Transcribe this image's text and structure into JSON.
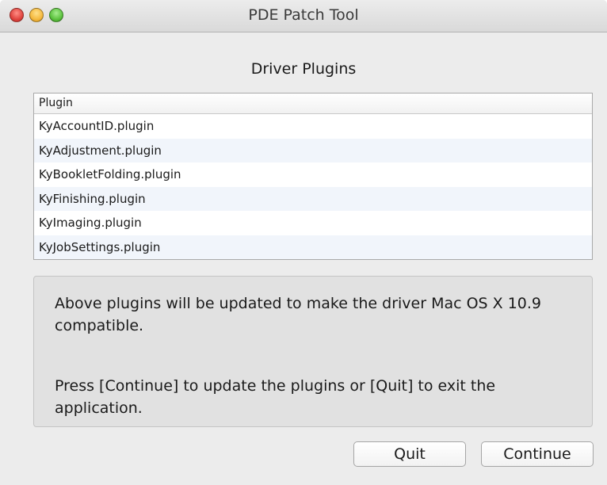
{
  "window": {
    "title": "PDE Patch Tool"
  },
  "section_title": "Driver Plugins",
  "table": {
    "header": "Plugin",
    "rows": [
      "KyAccountID.plugin",
      "KyAdjustment.plugin",
      "KyBookletFolding.plugin",
      "KyFinishing.plugin",
      "KyImaging.plugin",
      "KyJobSettings.plugin"
    ]
  },
  "message": {
    "line1": "Above plugins will be updated to make the driver Mac OS X 10.9 compatible.",
    "line2": "Press [Continue] to update the plugins or [Quit] to exit the application."
  },
  "buttons": {
    "quit": "Quit",
    "continue": "Continue"
  },
  "colors": {
    "window_bg": "#ececec",
    "alt_row": "#f1f5fb",
    "message_bg": "#e1e1e1",
    "close": "#e0443e",
    "minimize": "#f5b93e",
    "zoom": "#5cc23e"
  }
}
